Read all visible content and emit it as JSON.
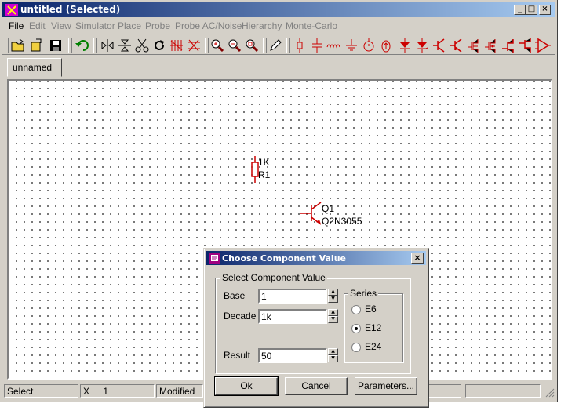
{
  "window": {
    "title": "untitled (Selected)",
    "controls": [
      "minimize",
      "maximize",
      "close"
    ]
  },
  "menu": {
    "items": [
      {
        "label": "File",
        "enabled": true
      },
      {
        "label": "Edit",
        "enabled": false
      },
      {
        "label": "View",
        "enabled": false
      },
      {
        "label": "Simulator",
        "enabled": false
      },
      {
        "label": "Place",
        "enabled": false
      },
      {
        "label": "Probe",
        "enabled": false
      },
      {
        "label": "Probe AC/Noise",
        "enabled": false
      },
      {
        "label": "Hierarchy",
        "enabled": false
      },
      {
        "label": "Monte-Carlo",
        "enabled": false
      }
    ]
  },
  "toolbar": {
    "icons": [
      "open-folder-icon",
      "new-file-icon",
      "save-icon",
      "undo-icon",
      "flip-horizontal-icon",
      "flip-vertical-icon",
      "cut-icon",
      "rotate-icon",
      "mirror-icon",
      "delete-wire-icon",
      "zoom-in-icon",
      "zoom-out-icon",
      "zoom-fit-icon",
      "pencil-icon",
      "resistor-icon",
      "capacitor-icon",
      "inductor-icon",
      "ground-icon",
      "voltage-source-icon",
      "current-source-icon",
      "diode-icon",
      "zener-icon",
      "npn-icon",
      "pnp-icon",
      "nmos-icon",
      "pmos-icon",
      "njfet-icon",
      "pjfet-icon",
      "opamp-icon"
    ],
    "accent_color": "#cc0000"
  },
  "tabs": [
    {
      "label": "unnamed",
      "active": true
    }
  ],
  "schematic": {
    "components": [
      {
        "kind": "resistor",
        "value": "1K",
        "ref": "R1"
      },
      {
        "kind": "transistor",
        "value": "Q1",
        "ref": "Q2N3055"
      }
    ],
    "component_color": "#cc0000"
  },
  "statusbar": {
    "mode": "Select",
    "x_label": "X",
    "x_value": "1",
    "state": "Modified"
  },
  "dialog": {
    "title": "Choose Component Value",
    "group_label": "Select Component Value",
    "base_label": "Base",
    "base_value": "1",
    "decade_label": "Decade",
    "decade_value": "1k",
    "result_label": "Result",
    "result_value": "50",
    "series_label": "Series",
    "series": [
      {
        "label": "E6",
        "selected": false
      },
      {
        "label": "E12",
        "selected": true
      },
      {
        "label": "E24",
        "selected": false
      }
    ],
    "ok_label": "Ok",
    "cancel_label": "Cancel",
    "parameters_label": "Parameters..."
  }
}
